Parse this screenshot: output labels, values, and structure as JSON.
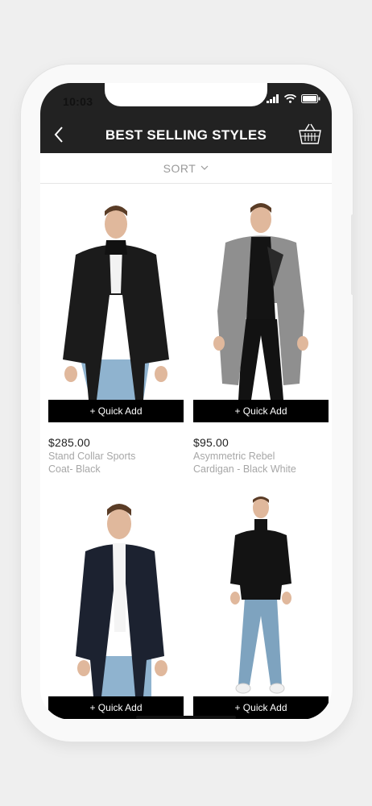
{
  "status": {
    "time": "10:03"
  },
  "header": {
    "title": "BEST SELLING STYLES",
    "back_icon": "chevron-left-icon",
    "cart_icon": "basket-icon"
  },
  "sort": {
    "label": "SORT"
  },
  "products": [
    {
      "price": "$285.00",
      "name_line1": "Stand Collar Sports",
      "name_line2": "Coat- Black",
      "button": "+ Quick Add"
    },
    {
      "price": "$95.00",
      "name_line1": "Asymmetric Rebel",
      "name_line2": "Cardigan - Black White",
      "button": "+ Quick Add"
    },
    {
      "button": "+ Quick Add"
    },
    {
      "button": "+ Quick Add"
    }
  ],
  "colors": {
    "bar": "#222222",
    "button": "#000000",
    "muted_text": "#a7a7a7"
  }
}
